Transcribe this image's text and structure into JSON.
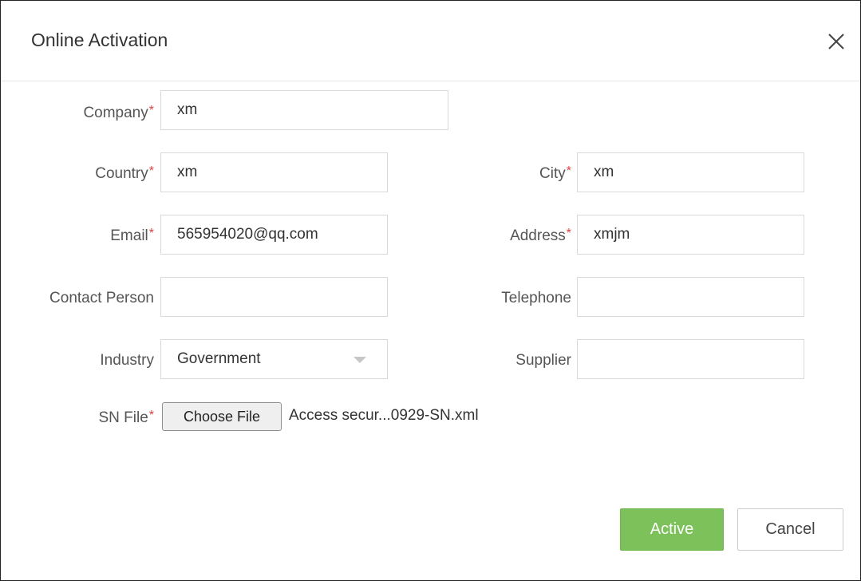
{
  "dialog": {
    "title": "Online Activation",
    "close_icon": "close-icon"
  },
  "required_mark": "*",
  "form": {
    "company": {
      "label": "Company",
      "value": "xm"
    },
    "country": {
      "label": "Country",
      "value": "xm"
    },
    "city": {
      "label": "City",
      "value": "xm"
    },
    "email": {
      "label": "Email",
      "value": "565954020@qq.com"
    },
    "address": {
      "label": "Address",
      "value": "xmjm"
    },
    "contact_person": {
      "label": "Contact Person",
      "value": ""
    },
    "telephone": {
      "label": "Telephone",
      "value": ""
    },
    "industry": {
      "label": "Industry",
      "value": "Government",
      "icon": "chevron-down-icon"
    },
    "supplier": {
      "label": "Supplier",
      "value": ""
    },
    "sn_file": {
      "label": "SN File",
      "button_label": "Choose File",
      "file_name": "Access secur...0929-SN.xml"
    }
  },
  "buttons": {
    "active_label": "Active",
    "cancel_label": "Cancel"
  },
  "colors": {
    "primary_button": "#7cc15a",
    "required_mark": "#e0413e",
    "border": "#d9d9d9"
  }
}
